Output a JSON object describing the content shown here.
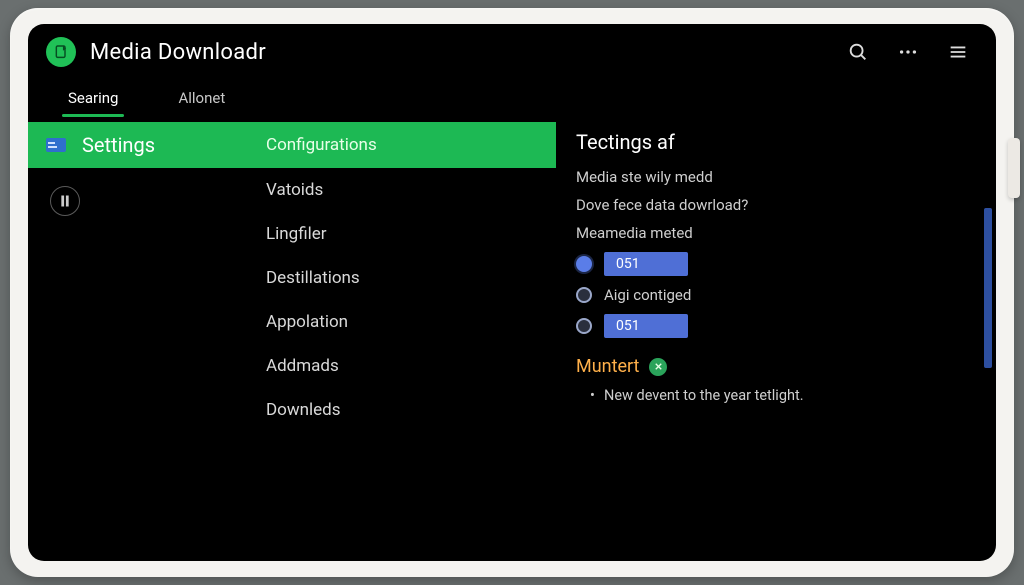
{
  "app": {
    "title": "Media Downloadr"
  },
  "tabs": [
    {
      "label": "Searing",
      "active": true
    },
    {
      "label": "Allonet",
      "active": false
    }
  ],
  "sidebar": {
    "settings_label": "Settings"
  },
  "categories": [
    {
      "label": "Configurations",
      "active": true
    },
    {
      "label": "Vatoids"
    },
    {
      "label": "Lingfiler"
    },
    {
      "label": "Destillations"
    },
    {
      "label": "Appolation"
    },
    {
      "label": "Addmads"
    },
    {
      "label": "Downleds"
    }
  ],
  "panel": {
    "title": "Tectings af",
    "line1": "Media ste wily medd",
    "line2": "Dove fece data dowrload?",
    "line3": "Meamedia meted",
    "options": [
      {
        "kind": "radio_selected",
        "value": "051"
      },
      {
        "kind": "radio_empty_label",
        "label": "Aigi contiged"
      },
      {
        "kind": "radio_empty_value",
        "value": "051"
      }
    ],
    "subheading": "Muntert",
    "bullet": "New devent to the year tetlight."
  },
  "colors": {
    "accent_green": "#1db954",
    "accent_blue": "#4f6fd6",
    "warn_orange": "#ffb04a"
  }
}
